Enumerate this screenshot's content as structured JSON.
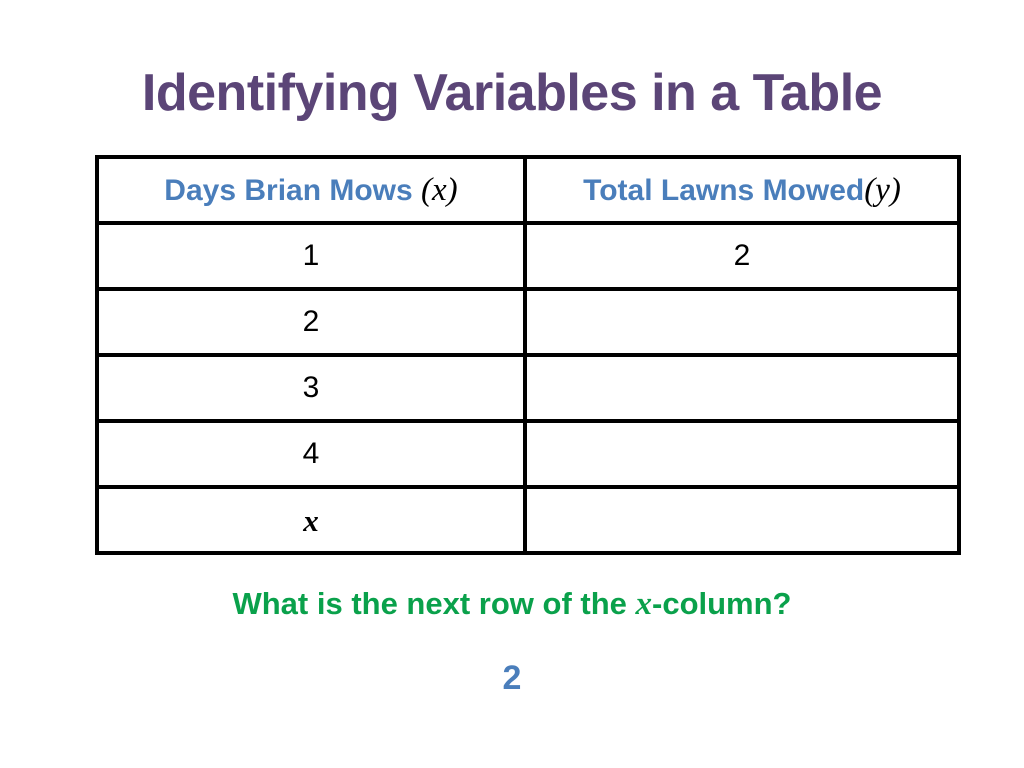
{
  "slide": {
    "title": "Identifying Variables in a Table",
    "title_color": "#5B4577",
    "background_color": "#FFFFFF"
  },
  "table": {
    "border_color": "#000000",
    "header_text_color": "#4A7EBB",
    "headers": [
      {
        "label": "Days Brian Mows ",
        "variable": "(x)"
      },
      {
        "label": "Total Lawns Mowed",
        "variable": "(y)"
      }
    ],
    "rows": [
      {
        "x": "1",
        "y": "2"
      },
      {
        "x": "2",
        "y": ""
      },
      {
        "x": "3",
        "y": ""
      },
      {
        "x": "4",
        "y": ""
      },
      {
        "x": "x",
        "y": ""
      }
    ]
  },
  "question": {
    "part1": "What is the next row of the ",
    "variable": "x",
    "part2": "-column?",
    "color": "#0AA14B"
  },
  "answer": {
    "value": "2",
    "color": "#4A7EBB"
  }
}
